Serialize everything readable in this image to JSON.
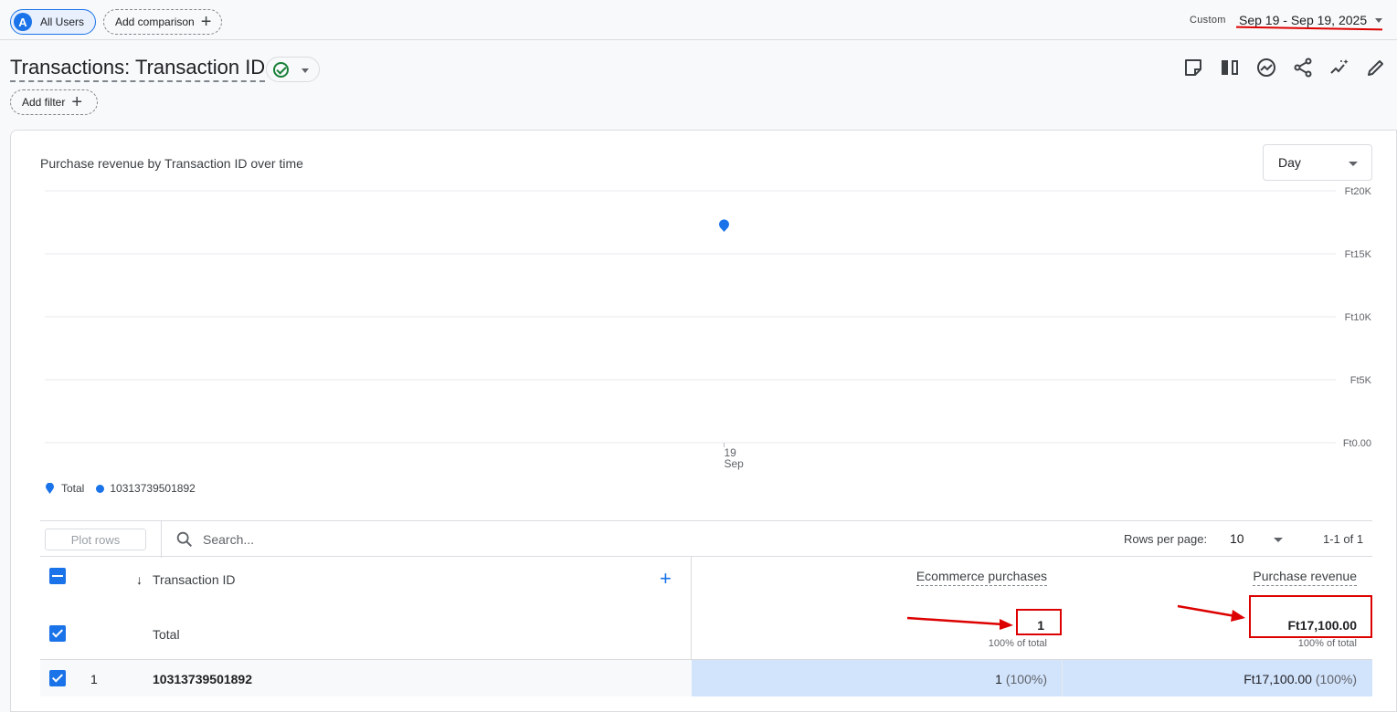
{
  "topbar": {
    "segment_avatar": "A",
    "segment_label": "All Users",
    "add_comparison_label": "Add comparison",
    "date_mode": "Custom",
    "date_range": "Sep 19 - Sep 19, 2025"
  },
  "header": {
    "title": "Transactions: Transaction ID",
    "add_filter_label": "Add filter",
    "toolbar_icons": [
      "note-icon",
      "compare-columns-icon",
      "insights-icon",
      "share-icon",
      "trend-sparkle-icon",
      "edit-pencil-icon"
    ]
  },
  "chart": {
    "title": "Purchase revenue by Transaction ID over time",
    "granularity": "Day",
    "legend": [
      "Total",
      "10313739501892"
    ],
    "colors": {
      "total": "#1a73e8",
      "series": "#1a73e8",
      "accent": "#1a73e8",
      "annotation": "#dd0000"
    }
  },
  "chart_data": {
    "type": "line",
    "title": "Purchase revenue by Transaction ID over time",
    "x_ticks": [
      {
        "day": "19",
        "month": "Sep"
      }
    ],
    "y_ticks": [
      "Ft0.00",
      "Ft5K",
      "Ft10K",
      "Ft15K",
      "Ft20K"
    ],
    "ylim": [
      0,
      20000
    ],
    "series": [
      {
        "name": "Total",
        "points": [
          {
            "x": "Sep 19",
            "y": 17100
          }
        ]
      },
      {
        "name": "10313739501892",
        "points": [
          {
            "x": "Sep 19",
            "y": 17100
          }
        ]
      }
    ],
    "grid": true,
    "legend_position": "bottom-left"
  },
  "table": {
    "plot_rows_label": "Plot rows",
    "search_placeholder": "Search...",
    "rows_per_page_label": "Rows per page:",
    "rows_per_page_value": "10",
    "page_count": "1-1 of 1",
    "dimension_header": "Transaction ID",
    "add_column": "+",
    "metric_headers": [
      "Ecommerce purchases",
      "Purchase revenue"
    ],
    "total_label": "Total",
    "totals": [
      "1",
      "Ft17,100.00"
    ],
    "totals_pct": [
      "100% of total",
      "100% of total"
    ],
    "rows": [
      {
        "index": "1",
        "id": "10313739501892",
        "purchases": "1",
        "purchases_pct": "(100%)",
        "revenue": "Ft17,100.00",
        "revenue_pct": "(100%)"
      }
    ]
  }
}
